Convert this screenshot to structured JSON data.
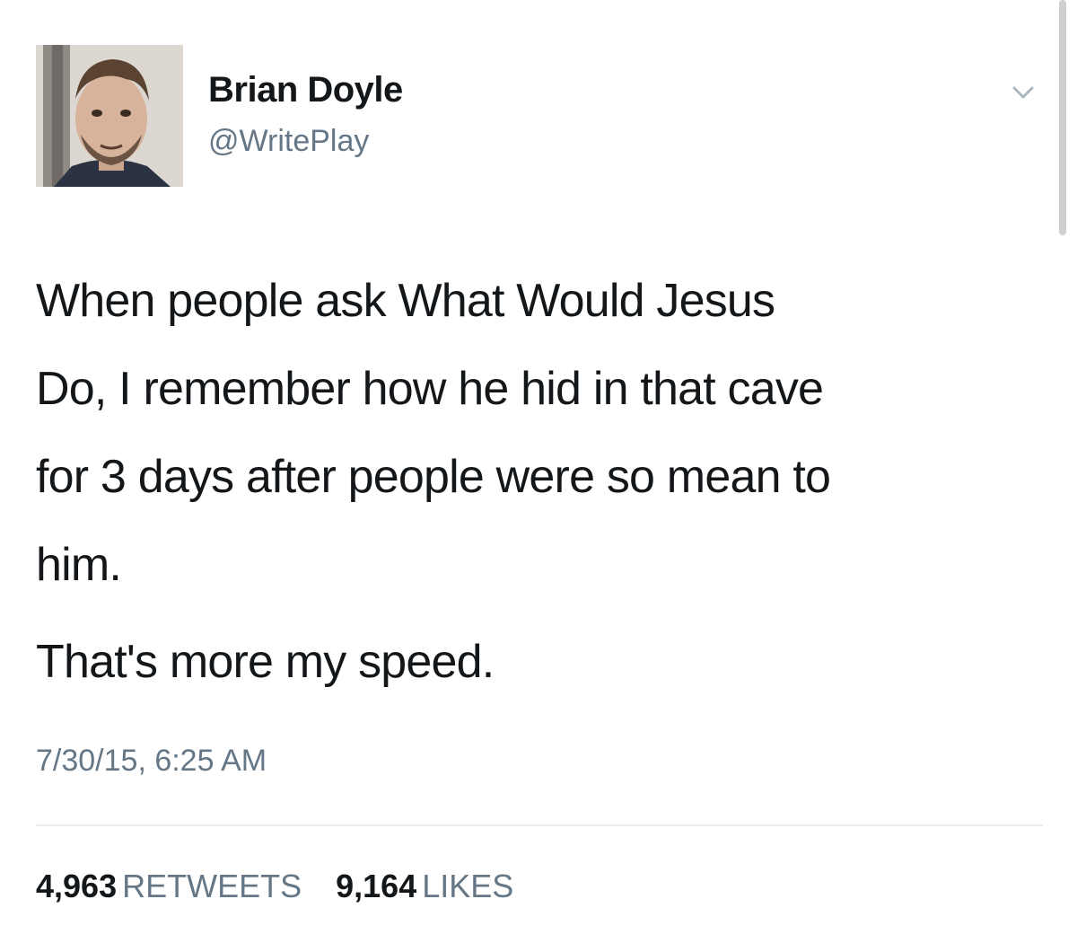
{
  "user": {
    "name": "Brian Doyle",
    "handle": "@WritePlay"
  },
  "tweet": {
    "paragraphs": [
      "When people ask What Would Jesus\nDo, I remember how he hid in that cave\nfor 3 days after people were so mean to\nhim.",
      "That's more my speed."
    ],
    "timestamp": "7/30/15, 6:25 AM"
  },
  "stats": {
    "retweets_count": "4,963",
    "retweets_label": "RETWEETS",
    "likes_count": "9,164",
    "likes_label": "LIKES"
  },
  "icons": {
    "menu": "chevron-down-icon",
    "avatar": "profile-photo"
  },
  "colors": {
    "text": "#14171a",
    "secondary_text": "#657786",
    "divider": "#e6ecf0"
  }
}
